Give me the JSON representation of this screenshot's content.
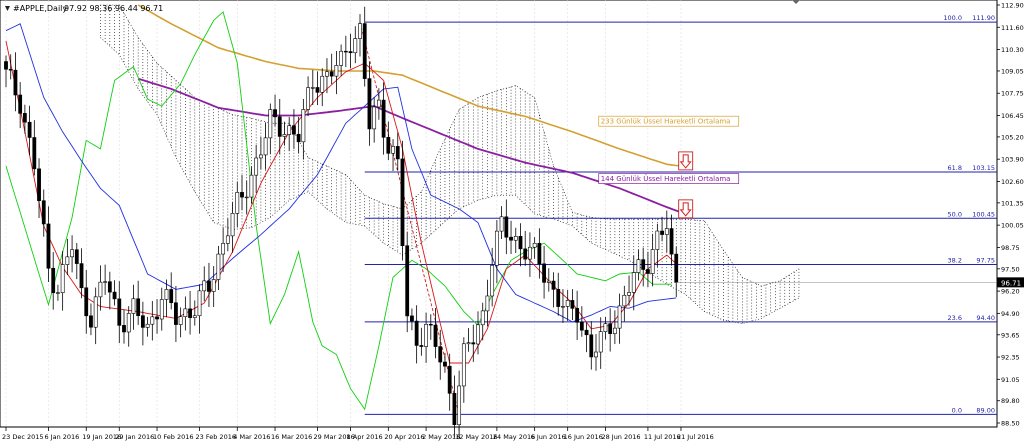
{
  "header": {
    "symbol": "#APPLE,Daily",
    "ohlc": "97.92 98.36 96.44 96.71"
  },
  "colors": {
    "bull": "#ffffff",
    "bear": "#000000",
    "grid": "#dadada",
    "ema233": "#d4a030",
    "ema144": "#8a1fa0",
    "tenkan": "#d81818",
    "kijun": "#1f2fe0",
    "chikou": "#10d010",
    "fib": "#2222aa",
    "cloud": "#000000",
    "price_tag": "#000000"
  },
  "chart_data": {
    "type": "candlestick",
    "title": "",
    "ylim": [
      88.5,
      112.9
    ],
    "y_ticks": [
      "112.90",
      "111.60",
      "110.30",
      "109.05",
      "107.75",
      "106.45",
      "105.20",
      "103.90",
      "102.60",
      "101.35",
      "100.05",
      "98.75",
      "97.50",
      "96.20",
      "94.90",
      "93.65",
      "92.35",
      "91.05",
      "89.80",
      "88.50"
    ],
    "y_tick_values": [
      112.9,
      111.6,
      110.3,
      109.05,
      107.75,
      106.45,
      105.2,
      103.9,
      102.6,
      101.35,
      100.05,
      98.75,
      97.5,
      96.2,
      94.9,
      93.65,
      92.35,
      91.05,
      89.8,
      88.5
    ],
    "x_ticks": [
      "23 Dec 2015",
      "6 Jan 2016",
      "19 Jan 2016",
      "29 Jan 2016",
      "10 Feb 2016",
      "23 Feb 2016",
      "4 Mar 2016",
      "16 Mar 2016",
      "29 Mar 2016",
      "8 Apr 2016",
      "20 Apr 2016",
      "2 May 2016",
      "12 May 2016",
      "24 May 2016",
      "6 Jun 2016",
      "16 Jun 2016",
      "28 Jun 2016",
      "11 Jul 2016",
      "21 Jul 2016"
    ],
    "x_tick_index": [
      0,
      9,
      17,
      24,
      32,
      41,
      49,
      57,
      66,
      73,
      81,
      89,
      96,
      104,
      112,
      119,
      127,
      136,
      143
    ],
    "current_price": "96.71",
    "current_price_value": 96.71,
    "fib_levels": [
      {
        "pct": "100.0",
        "label": "111.90",
        "value": 111.9
      },
      {
        "pct": "61.8",
        "label": "103.15",
        "value": 103.15
      },
      {
        "pct": "50.0",
        "label": "100.45",
        "value": 100.45
      },
      {
        "pct": "38.2",
        "label": "97.75",
        "value": 97.75
      },
      {
        "pct": "23.6",
        "label": "94.40",
        "value": 94.4
      },
      {
        "pct": "0.0",
        "label": "89.00",
        "value": 89.0
      }
    ],
    "fib_start_index": 76,
    "annotations": [
      {
        "text": "233 Günlük Üssel Hareketli Ortalama",
        "x_index": 126,
        "y": 106.0,
        "color": "ema233"
      },
      {
        "text": "144 Günlük Üssel Hareketli Ortalama",
        "x_index": 126,
        "y": 102.65,
        "color": "ema144"
      }
    ],
    "arrows": [
      {
        "x_index": 144,
        "y": 103.8
      },
      {
        "x_index": 144,
        "y": 101.0
      }
    ],
    "ohlc_anchors": [
      [
        0,
        108.8
      ],
      [
        3,
        107.4
      ],
      [
        6,
        103.5
      ],
      [
        9,
        97.4
      ],
      [
        11,
        96.5
      ],
      [
        14,
        98.8
      ],
      [
        16,
        96.0
      ],
      [
        18,
        94.8
      ],
      [
        21,
        96.9
      ],
      [
        24,
        94.5
      ],
      [
        27,
        95.0
      ],
      [
        30,
        94.0
      ],
      [
        33,
        96.0
      ],
      [
        36,
        94.6
      ],
      [
        40,
        95.3
      ],
      [
        43,
        96.4
      ],
      [
        47,
        100.0
      ],
      [
        50,
        101.6
      ],
      [
        53,
        103.8
      ],
      [
        56,
        106.0
      ],
      [
        59,
        105.8
      ],
      [
        62,
        105.2
      ],
      [
        65,
        108.5
      ],
      [
        68,
        108.7
      ],
      [
        71,
        109.5
      ],
      [
        73,
        111.0
      ],
      [
        75,
        111.3
      ],
      [
        77,
        105.8
      ],
      [
        79,
        107.1
      ],
      [
        81,
        104.8
      ],
      [
        83,
        103.5
      ],
      [
        85,
        94.6
      ],
      [
        87,
        93.5
      ],
      [
        89,
        94.0
      ],
      [
        91,
        93.0
      ],
      [
        93,
        91.5
      ],
      [
        95,
        89.2
      ],
      [
        97,
        92.3
      ],
      [
        99,
        93.5
      ],
      [
        101,
        94.9
      ],
      [
        103,
        98.1
      ],
      [
        105,
        99.9
      ],
      [
        107,
        99.5
      ],
      [
        110,
        98.6
      ],
      [
        113,
        97.9
      ],
      [
        116,
        96.2
      ],
      [
        119,
        94.8
      ],
      [
        121,
        95.1
      ],
      [
        124,
        92.5
      ],
      [
        126,
        93.2
      ],
      [
        128,
        94.3
      ],
      [
        130,
        95.1
      ],
      [
        133,
        97.0
      ],
      [
        136,
        98.1
      ],
      [
        138,
        99.2
      ],
      [
        140,
        99.9
      ],
      [
        141,
        97.8
      ],
      [
        142,
        96.71
      ]
    ],
    "tenkan_anchors": [
      [
        0,
        110.8
      ],
      [
        4,
        105.5
      ],
      [
        8,
        100.0
      ],
      [
        12,
        97.6
      ],
      [
        16,
        96.0
      ],
      [
        20,
        95.3
      ],
      [
        28,
        95.0
      ],
      [
        36,
        94.6
      ],
      [
        42,
        95.5
      ],
      [
        48,
        98.5
      ],
      [
        54,
        102.5
      ],
      [
        60,
        105.5
      ],
      [
        66,
        107.5
      ],
      [
        72,
        109.0
      ],
      [
        76,
        109.5
      ],
      [
        80,
        108.5
      ],
      [
        84,
        104.5
      ],
      [
        88,
        99.0
      ],
      [
        94,
        92.0
      ],
      [
        98,
        92.0
      ],
      [
        102,
        94.0
      ],
      [
        106,
        97.5
      ],
      [
        110,
        98.3
      ],
      [
        116,
        96.5
      ],
      [
        120,
        95.5
      ],
      [
        124,
        94.0
      ],
      [
        128,
        94.2
      ],
      [
        132,
        95.5
      ],
      [
        136,
        97.5
      ],
      [
        140,
        98.3
      ],
      [
        142,
        97.8
      ]
    ],
    "kijun_anchors": [
      [
        0,
        111.4
      ],
      [
        3,
        111.8
      ],
      [
        8,
        107.5
      ],
      [
        12,
        105.5
      ],
      [
        16,
        103.8
      ],
      [
        20,
        102.2
      ],
      [
        24,
        101.2
      ],
      [
        30,
        97.2
      ],
      [
        36,
        96.3
      ],
      [
        42,
        96.6
      ],
      [
        48,
        98.1
      ],
      [
        54,
        99.5
      ],
      [
        60,
        101.0
      ],
      [
        66,
        103.0
      ],
      [
        72,
        106.0
      ],
      [
        76,
        107.0
      ],
      [
        80,
        108.0
      ],
      [
        83,
        108.1
      ],
      [
        86,
        104.5
      ],
      [
        90,
        101.8
      ],
      [
        96,
        101.0
      ],
      [
        100,
        100.2
      ],
      [
        104,
        97.5
      ],
      [
        108,
        96.0
      ],
      [
        112,
        95.5
      ],
      [
        116,
        95.0
      ],
      [
        120,
        94.4
      ],
      [
        124,
        94.8
      ],
      [
        128,
        95.3
      ],
      [
        132,
        95.2
      ],
      [
        136,
        95.6
      ],
      [
        142,
        95.8
      ]
    ],
    "chikou_anchors": [
      [
        0,
        103.5
      ],
      [
        5,
        99.0
      ],
      [
        9,
        95.4
      ],
      [
        14,
        100.5
      ],
      [
        17,
        105.0
      ],
      [
        20,
        104.5
      ],
      [
        23,
        108.5
      ],
      [
        27,
        109.3
      ],
      [
        30,
        107.4
      ],
      [
        33,
        107.0
      ],
      [
        37,
        108.3
      ],
      [
        40,
        110.0
      ],
      [
        44,
        112.0
      ],
      [
        46,
        112.5
      ],
      [
        49,
        109.5
      ],
      [
        53,
        100.0
      ],
      [
        56,
        94.3
      ],
      [
        59,
        96.0
      ],
      [
        62,
        98.5
      ],
      [
        65,
        94.4
      ],
      [
        67,
        93.0
      ],
      [
        70,
        92.5
      ],
      [
        73,
        90.5
      ],
      [
        76,
        89.3
      ],
      [
        79,
        93.0
      ],
      [
        82,
        97.0
      ],
      [
        86,
        98.0
      ],
      [
        89,
        97.5
      ],
      [
        93,
        96.5
      ],
      [
        97,
        95.0
      ],
      [
        100,
        94.2
      ],
      [
        103,
        96.0
      ],
      [
        107,
        98.0
      ],
      [
        110,
        98.5
      ],
      [
        114,
        99.0
      ],
      [
        118,
        98.0
      ],
      [
        121,
        97.2
      ],
      [
        124,
        97.0
      ],
      [
        127,
        96.8
      ],
      [
        130,
        97.2
      ],
      [
        134,
        97.3
      ],
      [
        137,
        96.6
      ],
      [
        141,
        96.6
      ]
    ],
    "ema144_anchors": [
      [
        28,
        108.6
      ],
      [
        35,
        108.0
      ],
      [
        45,
        106.9
      ],
      [
        55,
        106.45
      ],
      [
        62,
        106.45
      ],
      [
        70,
        106.7
      ],
      [
        78,
        107.0
      ],
      [
        84,
        106.3
      ],
      [
        92,
        105.4
      ],
      [
        100,
        104.5
      ],
      [
        110,
        103.7
      ],
      [
        120,
        103.1
      ],
      [
        130,
        102.2
      ],
      [
        140,
        101.1
      ],
      [
        143,
        100.8
      ]
    ],
    "ema233_anchors": [
      [
        28,
        112.9
      ],
      [
        35,
        111.8
      ],
      [
        45,
        110.4
      ],
      [
        55,
        109.6
      ],
      [
        62,
        109.2
      ],
      [
        70,
        109.05
      ],
      [
        78,
        109.05
      ],
      [
        84,
        108.8
      ],
      [
        92,
        107.9
      ],
      [
        100,
        107.0
      ],
      [
        110,
        106.4
      ],
      [
        120,
        105.5
      ],
      [
        130,
        104.5
      ],
      [
        140,
        103.6
      ],
      [
        143,
        103.5
      ]
    ],
    "cloud_bands": [
      [
        20,
        112.9,
        111.0
      ],
      [
        24,
        112.9,
        110.0
      ],
      [
        28,
        111.0,
        108.0
      ],
      [
        32,
        109.5,
        106.5
      ],
      [
        36,
        108.5,
        104.0
      ],
      [
        40,
        107.5,
        102.0
      ],
      [
        44,
        107.0,
        100.2
      ],
      [
        48,
        106.5,
        99.8
      ],
      [
        52,
        106.3,
        99.9
      ],
      [
        56,
        106.0,
        100.5
      ],
      [
        60,
        106.0,
        101.5
      ],
      [
        64,
        104.0,
        102.0
      ],
      [
        68,
        103.5,
        101.0
      ],
      [
        72,
        103.0,
        100.2
      ],
      [
        76,
        101.8,
        100.0
      ],
      [
        80,
        101.3,
        99.0
      ],
      [
        84,
        101.0,
        98.3
      ],
      [
        88,
        102.0,
        99.0
      ],
      [
        92,
        104.5,
        100.0
      ],
      [
        96,
        106.8,
        101.0
      ],
      [
        100,
        107.5,
        101.5
      ],
      [
        104,
        107.9,
        101.8
      ],
      [
        108,
        108.2,
        101.8
      ],
      [
        112,
        107.5,
        100.7
      ],
      [
        116,
        103.5,
        100.4
      ],
      [
        120,
        100.8,
        100.0
      ],
      [
        124,
        100.5,
        99.0
      ],
      [
        128,
        100.4,
        98.5
      ],
      [
        132,
        100.4,
        98.0
      ],
      [
        136,
        100.4,
        97.3
      ],
      [
        140,
        100.4,
        96.6
      ],
      [
        144,
        100.4,
        96.0
      ],
      [
        148,
        100.3,
        95.0
      ],
      [
        152,
        98.6,
        94.5
      ],
      [
        156,
        97.0,
        94.3
      ],
      [
        160,
        96.5,
        94.6
      ],
      [
        164,
        96.8,
        95.2
      ],
      [
        168,
        97.5,
        95.8
      ]
    ]
  }
}
